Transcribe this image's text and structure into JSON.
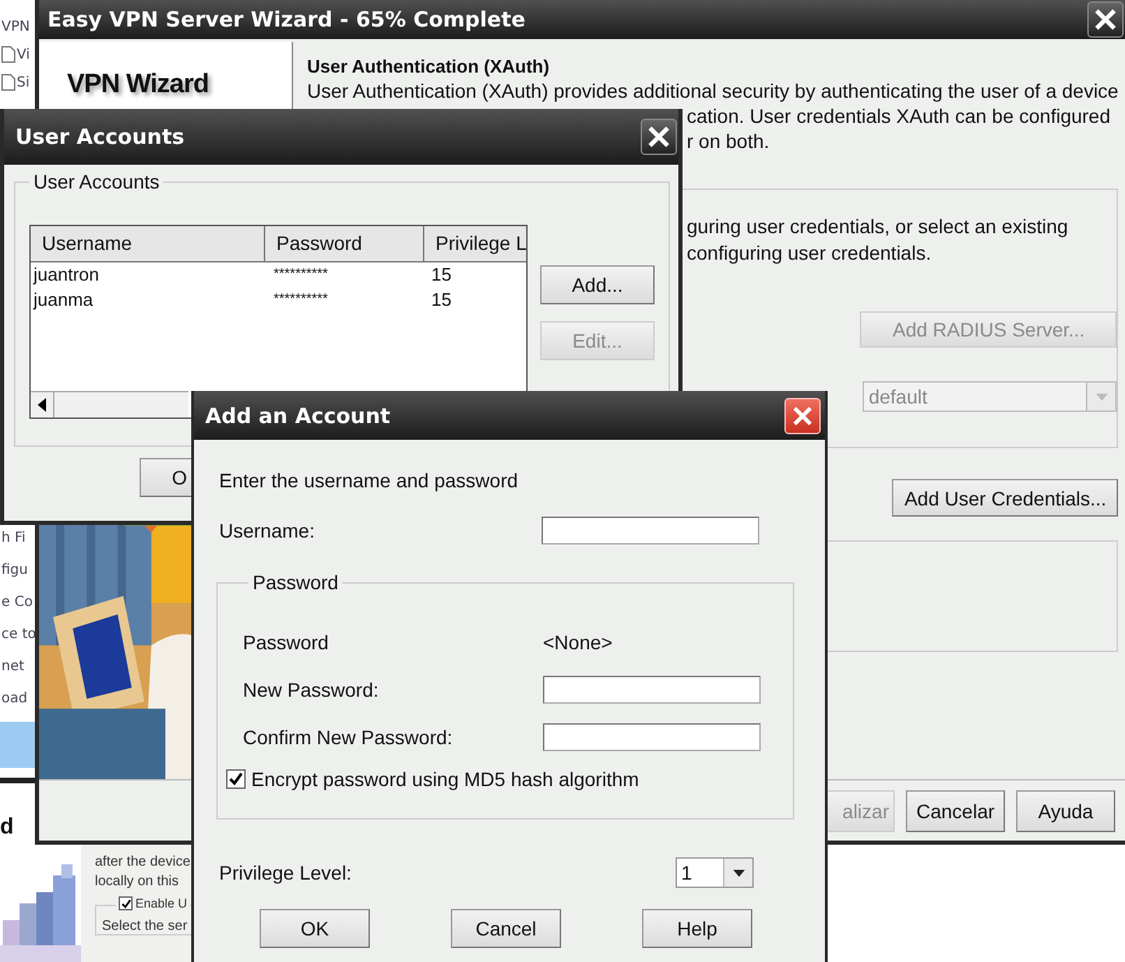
{
  "background_window": {
    "sidebar_top": [
      {
        "label": "VPN",
        "kind": "text",
        "selected": false
      },
      {
        "label": "Vi",
        "kind": "document",
        "selected": false
      },
      {
        "label": "Si",
        "kind": "document",
        "selected": false
      }
    ],
    "sidebar_bottom": [
      {
        "label": "h Fi",
        "kind": "text",
        "selected": false
      },
      {
        "label": "figu",
        "kind": "text",
        "selected": false
      },
      {
        "label": "e Co",
        "kind": "text",
        "selected": false
      },
      {
        "label": "ce to",
        "kind": "text",
        "selected": false
      },
      {
        "label": "net",
        "kind": "text",
        "selected": false
      },
      {
        "label": "oad",
        "kind": "text",
        "selected": false
      },
      {
        "kind": "text",
        "selected": true
      }
    ]
  },
  "lower_window": {
    "title": "d",
    "text_lines": [
      "after the device",
      "locally on this"
    ],
    "option": {
      "label": "Enable U",
      "checked": true
    },
    "note": "Select the ser"
  },
  "wizard": {
    "title": "Easy VPN Server Wizard - 65% Complete",
    "left_panel_title": "VPN Wizard",
    "heading": "User Authentication (XAuth)",
    "paragraph_lines": [
      "User Authentication (XAuth) provides additional security by authenticating the user of a device",
      "cation. User credentials XAuth can be configured",
      "r on both."
    ],
    "group_lines": [
      "guring user credentials, or select an existing",
      "configuring user credentials."
    ],
    "radius_button": {
      "label": "Add RADIUS Server...",
      "disabled": true
    },
    "method_combo": {
      "value": "default",
      "disabled": true
    },
    "credentials_button": {
      "label": "Add User Credentials...",
      "disabled": false
    },
    "footer_buttons": [
      {
        "label": "alizar",
        "disabled": true
      },
      {
        "label": "Cancelar",
        "disabled": false
      },
      {
        "label": "Ayuda",
        "disabled": false
      }
    ]
  },
  "user_accounts": {
    "title": "User Accounts",
    "group_title": "User Accounts",
    "columns": [
      "Username",
      "Password",
      "Privilege L"
    ],
    "rows": [
      {
        "cells": [
          "juantron",
          "**********",
          "15"
        ]
      },
      {
        "cells": [
          "juanma",
          "**********",
          "15"
        ]
      }
    ],
    "side_buttons": [
      {
        "label": "Add...",
        "disabled": false
      },
      {
        "label": "Edit...",
        "disabled": true
      }
    ],
    "ok_button": "O"
  },
  "add_account": {
    "title": "Add an Account",
    "instruction": "Enter the username and password",
    "username_label": "Username:",
    "password_group": "Password",
    "current_password_label": "Password",
    "current_password_value": "<None>",
    "new_password_label": "New Password:",
    "confirm_password_label": "Confirm New Password:",
    "encrypt": {
      "label": "Encrypt password using MD5 hash algorithm",
      "checked": true
    },
    "privilege_label": "Privilege Level:",
    "privilege_value": "1",
    "buttons": [
      "OK",
      "Cancel",
      "Help"
    ]
  }
}
